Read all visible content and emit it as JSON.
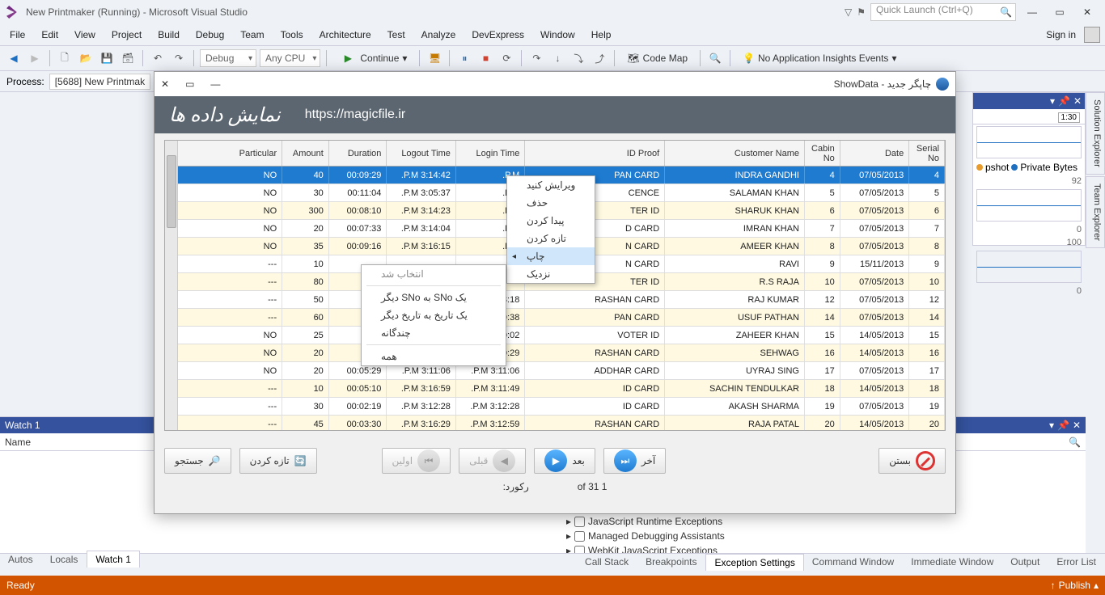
{
  "title": "New Printmaker (Running) - Microsoft Visual Studio",
  "quick_launch_placeholder": "Quick Launch (Ctrl+Q)",
  "menu": [
    "File",
    "Edit",
    "View",
    "Project",
    "Build",
    "Debug",
    "Team",
    "Tools",
    "Architecture",
    "Test",
    "Analyze",
    "DevExpress",
    "Window",
    "Help"
  ],
  "sign_in": "Sign in",
  "toolbar": {
    "config": "Debug",
    "platform": "Any CPU",
    "continue": "Continue",
    "codemap": "Code Map",
    "insights": "No Application Insights Events"
  },
  "process": {
    "label": "Process:",
    "value": "[5688] New Printmak"
  },
  "vtabs": [
    "Solution Explorer",
    "Team Explorer"
  ],
  "diag": {
    "tick": "1:30",
    "snap1": "pshot",
    "snap2": "Private Bytes",
    "vals": [
      "92",
      "0",
      "100",
      "0"
    ]
  },
  "watch": {
    "title": "Watch 1",
    "col": "Name"
  },
  "bottom_tabs_left": [
    "Autos",
    "Locals",
    "Watch 1"
  ],
  "bottom_tabs_right": [
    "Call Stack",
    "Breakpoints",
    "Exception Settings",
    "Command Window",
    "Immediate Window",
    "Output",
    "Error List"
  ],
  "status": {
    "ready": "Ready",
    "publish": "Publish"
  },
  "child": {
    "title": "چاپگر جدید - ShowData",
    "banner_fa": "نمایش داده ها",
    "banner_url": "https://magicfile.ir",
    "columns": [
      "Serial No",
      "Date",
      "Cabin No",
      "Customer Name",
      "ID Proof",
      "Login Time",
      "Logout Time",
      "Duration",
      "Amount",
      "Particular"
    ],
    "rows": [
      {
        "sn": "4",
        "dt": "07/05/2013",
        "cn": "4",
        "nm": "INDRA GANDHI",
        "id": "PAN CARD",
        "li": ".P.M",
        "lo": ".P.M 3:14:42",
        "du": "00:09:29",
        "am": "40",
        "pa": "NO",
        "sel": true
      },
      {
        "sn": "5",
        "dt": "07/05/2013",
        "cn": "5",
        "nm": "SALAMAN KHAN",
        "id": "CENCE",
        "li": ".P.M",
        "lo": ".P.M 3:05:37",
        "du": "00:11:04",
        "am": "30",
        "pa": "NO"
      },
      {
        "sn": "6",
        "dt": "07/05/2013",
        "cn": "6",
        "nm": "SHARUK KHAN",
        "id": "TER ID",
        "li": ".P.M",
        "lo": ".P.M 3:14:23",
        "du": "00:08:10",
        "am": "300",
        "pa": "NO",
        "alt": true
      },
      {
        "sn": "7",
        "dt": "07/05/2013",
        "cn": "7",
        "nm": "IMRAN KHAN",
        "id": "D CARD",
        "li": ".P.M",
        "lo": ".P.M 3:14:04",
        "du": "00:07:33",
        "am": "20",
        "pa": "NO"
      },
      {
        "sn": "8",
        "dt": "07/05/2013",
        "cn": "8",
        "nm": "AMEER KHAN",
        "id": "N CARD",
        "li": ".P.M",
        "lo": ".P.M 3:16:15",
        "du": "00:09:16",
        "am": "35",
        "pa": "NO",
        "alt": true
      },
      {
        "sn": "9",
        "dt": "15/11/2013",
        "cn": "9",
        "nm": "RAVI",
        "id": "N CARD",
        "li": "",
        "lo": "",
        "du": "",
        "am": "10",
        "pa": "---"
      },
      {
        "sn": "10",
        "dt": "07/05/2013",
        "cn": "10",
        "nm": "R.S RAJA",
        "id": "TER ID",
        "li": "",
        "lo": "",
        "du": "",
        "am": "80",
        "pa": "---",
        "alt": true
      },
      {
        "sn": "12",
        "dt": "07/05/2013",
        "cn": "12",
        "nm": "RAJ KUMAR",
        "id": "RASHAN CARD",
        "li": "3:08:18",
        "lo": "",
        "du": "",
        "am": "50",
        "pa": "---"
      },
      {
        "sn": "14",
        "dt": "07/05/2013",
        "cn": "14",
        "nm": "USUF PATHAN",
        "id": "PAN CARD",
        "li": "3:09:38",
        "lo": "",
        "du": "",
        "am": "60",
        "pa": "---",
        "alt": true
      },
      {
        "sn": "15",
        "dt": "14/05/2013",
        "cn": "15",
        "nm": "ZAHEER KHAN",
        "id": "VOTER ID",
        "li": "3:10:02",
        "lo": "",
        "du": "",
        "am": "25",
        "pa": "NO"
      },
      {
        "sn": "16",
        "dt": "14/05/2013",
        "cn": "16",
        "nm": "SEHWAG",
        "id": "RASHAN CARD",
        "li": "3:10:29",
        "lo": "",
        "du": "",
        "am": "20",
        "pa": "NO",
        "alt": true
      },
      {
        "sn": "17",
        "dt": "07/05/2013",
        "cn": "17",
        "nm": "UYRAJ SING",
        "id": "ADDHAR CARD",
        "li": ".P.M 3:11:06",
        "lo": ".P.M 3:11:06",
        "du": "00:05:29",
        "am": "20",
        "pa": "NO"
      },
      {
        "sn": "18",
        "dt": "14/05/2013",
        "cn": "18",
        "nm": "SACHIN TENDULKAR",
        "id": "ID CARD",
        "li": ".P.M 3:11:49",
        "lo": ".P.M 3:16:59",
        "du": "00:05:10",
        "am": "10",
        "pa": "---",
        "alt": true
      },
      {
        "sn": "19",
        "dt": "07/05/2013",
        "cn": "19",
        "nm": "AKASH SHARMA",
        "id": "ID CARD",
        "li": ".P.M 3:12:28",
        "lo": ".P.M 3:12:28",
        "du": "00:02:19",
        "am": "30",
        "pa": "---"
      },
      {
        "sn": "20",
        "dt": "14/05/2013",
        "cn": "20",
        "nm": "RAJA PATAL",
        "id": "RASHAN CARD",
        "li": ".P.M 3:12:59",
        "lo": ".P.M 3:16:29",
        "du": "00:03:30",
        "am": "45",
        "pa": "---",
        "alt": true
      }
    ],
    "ctx1": [
      "ویرایش کنید",
      "حذف",
      "پیدا کردن",
      "تازه کردن",
      "چاپ",
      "نزدیک"
    ],
    "ctx2_header": "انتخاب شد",
    "ctx2": [
      "یک SNo به SNo دیگر",
      "یک تاریخ به تاریخ دیگر",
      "چندگانه",
      "همه"
    ],
    "footer": {
      "search": "جستجو",
      "refresh": "تازه کردن",
      "first": "اولین",
      "prev": "قبلی",
      "next": "بعد",
      "last": "آخر",
      "close": "بستن",
      "record_pos": "of 31 1",
      "record_lbl": "رکورد:"
    }
  },
  "exceptions": [
    "JavaScript Runtime Exceptions",
    "Managed Debugging Assistants",
    "WebKit JavaScript Exceptions"
  ]
}
